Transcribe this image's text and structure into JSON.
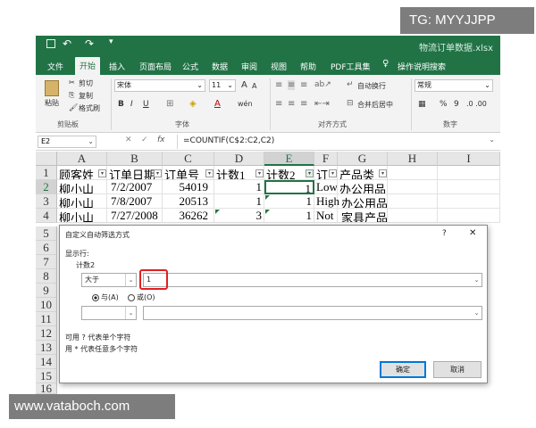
{
  "watermarks": {
    "top_right": "TG: MYYJJPP",
    "bottom_left": "www.vataboch.com"
  },
  "window": {
    "title": "物流订单数据.xlsx"
  },
  "ribbon_tabs": [
    "文件",
    "开始",
    "插入",
    "页面布局",
    "公式",
    "数据",
    "审阅",
    "视图",
    "帮助",
    "PDF工具集",
    "操作说明搜索"
  ],
  "ribbon": {
    "clipboard": {
      "paste": "粘贴",
      "cut": "剪切",
      "copy": "复制",
      "format_painter": "格式刷",
      "group": "剪贴板"
    },
    "font": {
      "name": "宋体",
      "size": "11",
      "group": "字体",
      "bold": "B",
      "italic": "I",
      "underline": "U",
      "font_color": "A",
      "phonetic": "wén",
      "grow": "A",
      "shrink": "A"
    },
    "alignment": {
      "wrap": "自动换行",
      "merge": "合并后居中",
      "group": "对齐方式"
    },
    "number": {
      "format": "常规",
      "percent": "%",
      "comma": "9",
      "group": "数字"
    }
  },
  "formula_bar": {
    "name_box": "E2",
    "fx": "fx",
    "formula": "=COUNTIF(C$2:C2,C2)"
  },
  "columns": [
    "A",
    "B",
    "C",
    "D",
    "E",
    "F",
    "G",
    "H",
    "I"
  ],
  "rows": [
    "1",
    "2",
    "3",
    "4",
    "5",
    "6",
    "7",
    "8",
    "9",
    "10",
    "11",
    "12",
    "13",
    "14",
    "15",
    "16"
  ],
  "headers": [
    "顾客姓",
    "订单日期",
    "订单号",
    "计数1",
    "计数2",
    "订",
    "产品类"
  ],
  "data_rows": [
    [
      "柳小山",
      "7/2/2007",
      "54019",
      "1",
      "1",
      "Low",
      "办公用品"
    ],
    [
      "柳小山",
      "7/8/2007",
      "20513",
      "1",
      "1",
      "High",
      "办公用品"
    ],
    [
      "柳小山",
      "7/27/2008",
      "36262",
      "3",
      "1",
      "Not",
      "家具产品"
    ]
  ],
  "dialog": {
    "title": "自定义自动筛选方式",
    "help": "?",
    "close": "✕",
    "show_rows": "显示行:",
    "field": "计数2",
    "operator1": "大于",
    "value1": "1",
    "and": "与(A)",
    "or": "或(O)",
    "operator2": "",
    "value2": "",
    "hint1": "可用 ? 代表单个字符",
    "hint2": "用 * 代表任意多个字符",
    "ok": "确定",
    "cancel": "取消"
  }
}
